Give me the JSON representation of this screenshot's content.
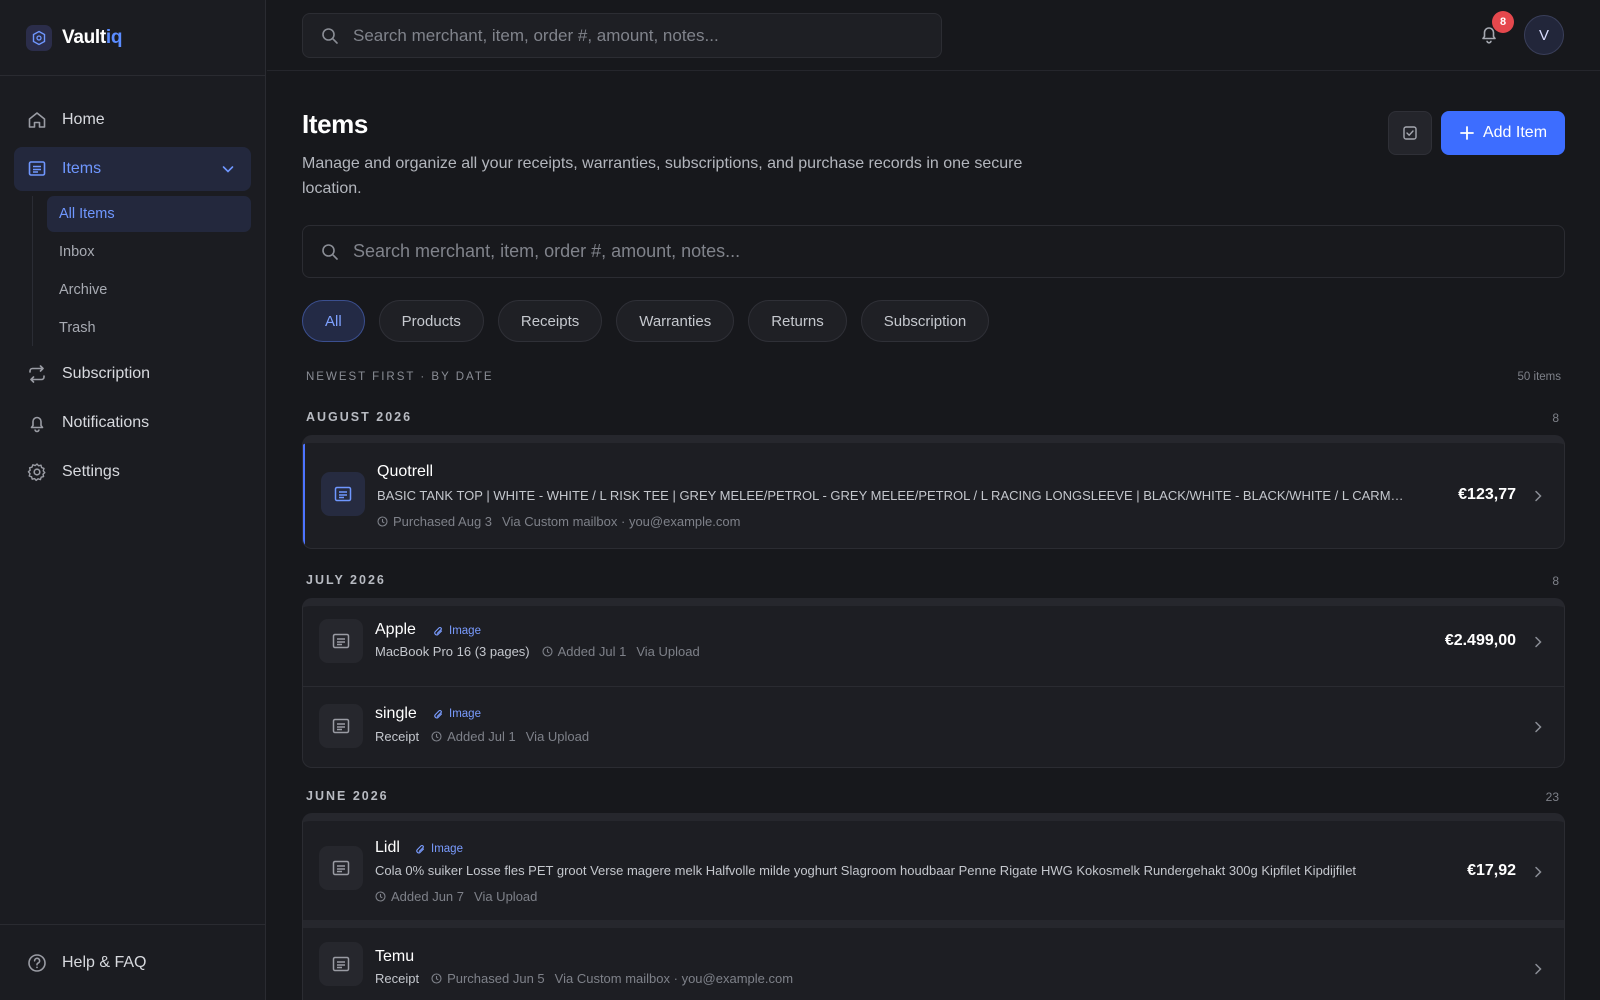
{
  "brand": {
    "name_main": "Vault",
    "name_accent": "iq"
  },
  "sidebar": {
    "items": [
      {
        "label": "Home",
        "icon": "home-icon"
      },
      {
        "label": "Items",
        "icon": "receipt-icon"
      },
      {
        "label": "Subscription",
        "icon": "repeat-icon"
      },
      {
        "label": "Notifications",
        "icon": "bell-icon"
      },
      {
        "label": "Settings",
        "icon": "gear-icon"
      }
    ],
    "sub_items": [
      {
        "label": "All Items"
      },
      {
        "label": "Inbox"
      },
      {
        "label": "Archive"
      },
      {
        "label": "Trash"
      }
    ],
    "footer": {
      "label": "Help & FAQ"
    }
  },
  "topbar": {
    "search_placeholder": "Search merchant, item, order #, amount, notes...",
    "notification_count": "8",
    "avatar_initial": "V"
  },
  "main": {
    "title": "Items",
    "description": "Manage and organize all your receipts, warranties, subscriptions, and purchase records in one secure location.",
    "add_label": "Add Item",
    "search_placeholder": "Search merchant, item, order #, amount, notes...",
    "filters": [
      {
        "label": "All"
      },
      {
        "label": "Products"
      },
      {
        "label": "Receipts"
      },
      {
        "label": "Warranties"
      },
      {
        "label": "Returns"
      },
      {
        "label": "Subscription"
      }
    ],
    "sort_label": "NEWEST FIRST · BY DATE",
    "total_count": "50 items"
  },
  "groups": [
    {
      "month": "AUGUST 2026",
      "count": "8",
      "rows": [
        {
          "merchant": "Quotrell",
          "subtitle": "BASIC TANK TOP | WHITE - WHITE / L RISK TEE | GREY MELEE/PETROL - GREY MELEE/PETROL / L RACING LONGSLEEVE | BLACK/WHITE - BLACK/WHITE / L CARMINE TEE | GREY M...",
          "date": "Purchased Aug 3",
          "via": "Via Custom mailbox · you@example.com",
          "price": "€123,77"
        }
      ]
    },
    {
      "month": "JULY 2026",
      "count": "8",
      "rows": [
        {
          "merchant": "Apple",
          "tag": "Image",
          "subtitle": "MacBook Pro 16 (3 pages)",
          "date": "Added Jul 1",
          "via": "Via Upload",
          "price": "€2.499,00"
        },
        {
          "merchant": "single",
          "tag": "Image",
          "subtitle": "Receipt",
          "date": "Added Jul 1",
          "via": "Via Upload",
          "price": ""
        }
      ]
    },
    {
      "month": "JUNE 2026",
      "count": "23",
      "rows": [
        {
          "merchant": "Lidl",
          "tag": "Image",
          "subtitle": "Cola 0% suiker Losse fles PET groot Verse magere melk Halfvolle milde yoghurt Slagroom houdbaar Penne Rigate HWG Kokosmelk Rundergehakt 300g Kipfilet Kipdijfilet",
          "date": "Added Jun 7",
          "via": "Via Upload",
          "price": "€17,92"
        },
        {
          "merchant": "Temu",
          "subtitle": "Receipt",
          "date": "Purchased Jun 5",
          "via": "Via Custom mailbox · you@example.com",
          "price": ""
        }
      ]
    }
  ],
  "colors": {
    "accent": "#3d6dff",
    "badge": "#e5484d",
    "background": "#17181c"
  }
}
